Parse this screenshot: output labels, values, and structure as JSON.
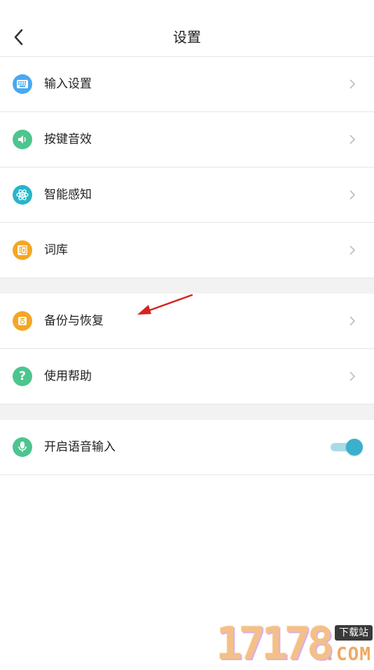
{
  "header": {
    "title": "设置"
  },
  "group1": [
    {
      "label": "输入设置",
      "icon": "keyboard-icon",
      "color": "#4aa8f0"
    },
    {
      "label": "按键音效",
      "icon": "speaker-icon",
      "color": "#4cc58f"
    },
    {
      "label": "智能感知",
      "icon": "atom-icon",
      "color": "#27b5c9"
    },
    {
      "label": "词库",
      "icon": "dictionary-icon",
      "color": "#f5a623"
    }
  ],
  "group2": [
    {
      "label": "备份与恢复",
      "icon": "backup-icon",
      "color": "#f5a623"
    },
    {
      "label": "使用帮助",
      "icon": "help-icon",
      "color": "#4cc58f"
    }
  ],
  "group3": [
    {
      "label": "开启语音输入",
      "icon": "microphone-icon",
      "color": "#4cc58f",
      "toggle_on": true
    }
  ],
  "watermark": {
    "digits": "17178",
    "badge": "下载站",
    "domain": ".COM"
  },
  "colors": {
    "accent": "#3ab0cd",
    "divider": "#e6e6e6",
    "section_gap": "#f2f2f2"
  }
}
